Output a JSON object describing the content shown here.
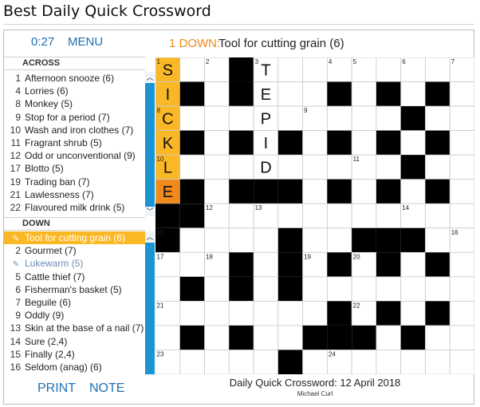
{
  "page_title": "Best Daily Quick Crossword",
  "header": {
    "timer": "0:27",
    "menu_label": "MENU"
  },
  "current_clue": {
    "number": "1 DOWN:",
    "text": "Tool for cutting grain (6)"
  },
  "across": {
    "heading": "ACROSS",
    "clues": [
      {
        "n": "1",
        "t": "Afternoon snooze (6)"
      },
      {
        "n": "4",
        "t": "Lorries (6)"
      },
      {
        "n": "8",
        "t": "Monkey (5)"
      },
      {
        "n": "9",
        "t": "Stop for a period (7)"
      },
      {
        "n": "10",
        "t": "Wash and iron clothes (7)"
      },
      {
        "n": "11",
        "t": "Fragrant shrub (5)"
      },
      {
        "n": "12",
        "t": "Odd or unconventional (9)"
      },
      {
        "n": "17",
        "t": "Blotto (5)"
      },
      {
        "n": "19",
        "t": "Trading ban (7)"
      },
      {
        "n": "21",
        "t": "Lawlessness (7)"
      },
      {
        "n": "22",
        "t": "Flavoured milk drink (5)"
      }
    ]
  },
  "down": {
    "heading": "DOWN",
    "clues": [
      {
        "n": "",
        "t": "Tool for cutting grain (6)",
        "state": "selected"
      },
      {
        "n": "2",
        "t": "Gourmet (7)"
      },
      {
        "n": "",
        "t": "Lukewarm (5)",
        "state": "done"
      },
      {
        "n": "5",
        "t": "Cattle thief (7)"
      },
      {
        "n": "6",
        "t": "Fisherman's basket (5)"
      },
      {
        "n": "7",
        "t": "Beguile (6)"
      },
      {
        "n": "9",
        "t": "Oddly (9)"
      },
      {
        "n": "13",
        "t": "Skin at the base of a nail (7)"
      },
      {
        "n": "14",
        "t": "Sure (2,4)"
      },
      {
        "n": "15",
        "t": "Finally (2,4)"
      },
      {
        "n": "16",
        "t": "Seldom (anag) (6)"
      }
    ]
  },
  "grid": {
    "size": 13,
    "rows": [
      "...#.........",
      ".#.#...#.#.#.",
      "..........#..",
      ".#.#.#.#.#.#.",
      "..........#..",
      ".#.###.#.#.#.",
      "##...........",
      "#....#..###..",
      "...#.#.#.#.#.",
      ".#.#.#.......",
      ".......#.#.#.",
      ".#.#..###.#..",
      ".....#......."
    ],
    "numbers": [
      {
        "r": 0,
        "c": 0,
        "n": "1"
      },
      {
        "r": 0,
        "c": 2,
        "n": "2"
      },
      {
        "r": 0,
        "c": 4,
        "n": "3"
      },
      {
        "r": 0,
        "c": 7,
        "n": "4"
      },
      {
        "r": 0,
        "c": 8,
        "n": "5"
      },
      {
        "r": 0,
        "c": 10,
        "n": "6"
      },
      {
        "r": 0,
        "c": 12,
        "n": "7"
      },
      {
        "r": 2,
        "c": 0,
        "n": "8"
      },
      {
        "r": 2,
        "c": 6,
        "n": "9"
      },
      {
        "r": 4,
        "c": 0,
        "n": "10"
      },
      {
        "r": 4,
        "c": 8,
        "n": "11"
      },
      {
        "r": 6,
        "c": 2,
        "n": "12"
      },
      {
        "r": 6,
        "c": 4,
        "n": "13"
      },
      {
        "r": 6,
        "c": 10,
        "n": "14"
      },
      {
        "r": 7,
        "c": 0,
        "n": "15"
      },
      {
        "r": 7,
        "c": 12,
        "n": "16"
      },
      {
        "r": 8,
        "c": 0,
        "n": "17"
      },
      {
        "r": 8,
        "c": 2,
        "n": "18"
      },
      {
        "r": 8,
        "c": 6,
        "n": "19"
      },
      {
        "r": 8,
        "c": 8,
        "n": "20"
      },
      {
        "r": 10,
        "c": 0,
        "n": "21"
      },
      {
        "r": 10,
        "c": 8,
        "n": "22"
      },
      {
        "r": 12,
        "c": 0,
        "n": "23"
      },
      {
        "r": 12,
        "c": 7,
        "n": "24"
      }
    ],
    "highlight_cells": [
      [
        0,
        0
      ],
      [
        1,
        0
      ],
      [
        2,
        0
      ],
      [
        3,
        0
      ],
      [
        4,
        0
      ]
    ],
    "active_cell": [
      5,
      0
    ],
    "letters": [
      {
        "r": 0,
        "c": 0,
        "l": "S"
      },
      {
        "r": 1,
        "c": 0,
        "l": "I"
      },
      {
        "r": 2,
        "c": 0,
        "l": "C"
      },
      {
        "r": 3,
        "c": 0,
        "l": "K"
      },
      {
        "r": 4,
        "c": 0,
        "l": "L"
      },
      {
        "r": 5,
        "c": 0,
        "l": "E"
      },
      {
        "r": 0,
        "c": 4,
        "l": "T"
      },
      {
        "r": 1,
        "c": 4,
        "l": "E"
      },
      {
        "r": 2,
        "c": 4,
        "l": "P"
      },
      {
        "r": 3,
        "c": 4,
        "l": "I"
      },
      {
        "r": 4,
        "c": 4,
        "l": "D"
      }
    ]
  },
  "footer": {
    "print_label": "PRINT",
    "note_label": "NOTE",
    "puzzle_title": "Daily Quick Crossword: 12 April 2018",
    "author": "Michael Curl"
  },
  "colors": {
    "accent": "#1f6fb3",
    "highlight": "#fbb826",
    "active": "#f08a1c",
    "scrollbar": "#1a95d2"
  }
}
